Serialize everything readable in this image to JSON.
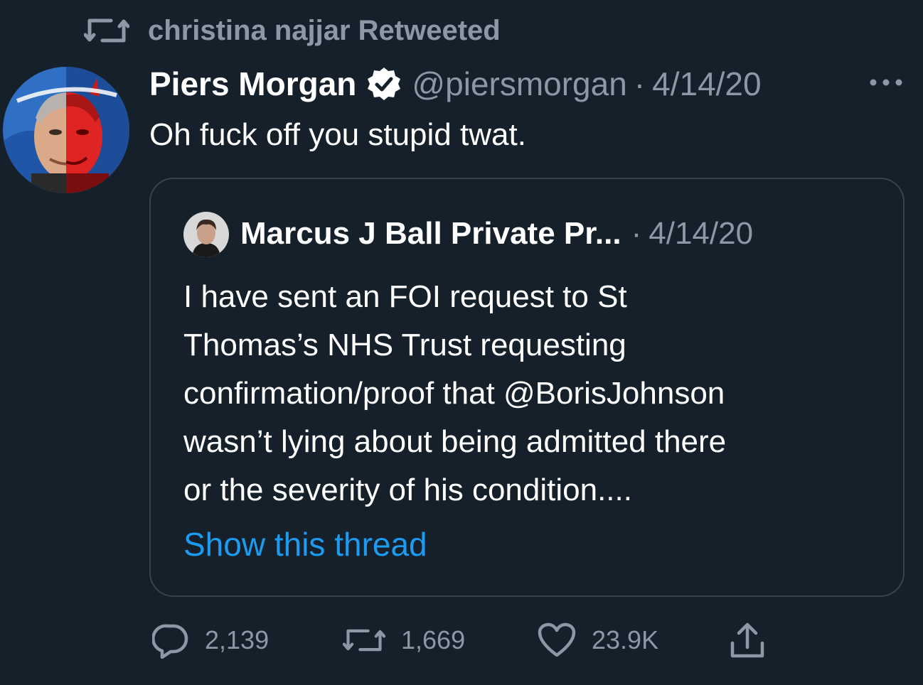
{
  "retweet_banner": {
    "text": "christina najjar Retweeted",
    "icon": "retweet-icon"
  },
  "tweet": {
    "author_name": "Piers Morgan",
    "verified_icon": "verified-badge-icon",
    "handle": "@piersmorgan",
    "separator": "·",
    "date": "4/14/20",
    "text": "Oh fuck off you stupid twat.",
    "more_icon": "more-options-icon"
  },
  "quote": {
    "author_name": "Marcus J Ball Private Pr...",
    "separator": "·",
    "date": "4/14/20",
    "text": "I have sent an FOI request to St\nThomas’s NHS Trust requesting\nconfirmation/proof that @BorisJohnson\nwasn’t lying about being admitted there\nor the severity of his condition....",
    "show_thread": "Show this thread"
  },
  "actions": {
    "reply_count": "2,139",
    "retweet_count": "1,669",
    "like_count": "23.9K",
    "share_icon": "share-icon"
  },
  "colors": {
    "background": "#15202b",
    "secondary_text": "#8b98a5",
    "accent": "#1d9bf0",
    "border": "#38444d"
  }
}
